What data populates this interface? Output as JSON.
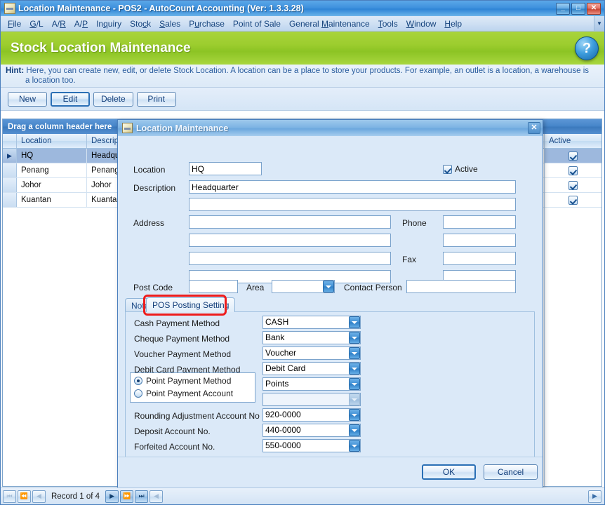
{
  "window": {
    "title": "Location Maintenance - POS2 - AutoCount Accounting (Ver: 1.3.3.28)",
    "icon": "app-icon",
    "minimize": "_",
    "maximize": "□",
    "close": "✕"
  },
  "menubar": {
    "items": [
      {
        "pre": "",
        "key": "F",
        "post": "ile"
      },
      {
        "pre": "",
        "key": "G",
        "post": "/L"
      },
      {
        "pre": "A/",
        "key": "R",
        "post": ""
      },
      {
        "pre": "A/",
        "key": "P",
        "post": ""
      },
      {
        "pre": "In",
        "key": "q",
        "post": "uiry"
      },
      {
        "pre": "Sto",
        "key": "c",
        "post": "k"
      },
      {
        "pre": "",
        "key": "S",
        "post": "ales"
      },
      {
        "pre": "P",
        "key": "u",
        "post": "rchase"
      },
      {
        "pre": "Point of Sale",
        "key": "",
        "post": ""
      },
      {
        "pre": "General ",
        "key": "M",
        "post": "aintenance"
      },
      {
        "pre": "",
        "key": "T",
        "post": "ools"
      },
      {
        "pre": "",
        "key": "W",
        "post": "indow"
      },
      {
        "pre": "",
        "key": "H",
        "post": "elp"
      }
    ],
    "overflow": "▼"
  },
  "banner": {
    "title": "Stock Location Maintenance",
    "help_glyph": "?"
  },
  "hint": {
    "label": "Hint:",
    "line1": "Here, you can create new, edit, or delete Stock Location. A location can be a place to store your products. For example, an outlet is a location, a warehouse is",
    "line2": "a location too."
  },
  "toolbar": {
    "new_label": "New",
    "edit_label": "Edit",
    "delete_label": "Delete",
    "print_label": "Print"
  },
  "grid": {
    "drag_hint": "Drag a column header here",
    "columns": [
      "Location",
      "Description"
    ],
    "active_column": "Active",
    "rows": [
      {
        "indicator": "▶",
        "location": "HQ",
        "description": "Headquarters",
        "active": true,
        "selected": true
      },
      {
        "indicator": "",
        "location": "Penang",
        "description": "Penang",
        "active": true,
        "selected": false
      },
      {
        "indicator": "",
        "location": "Johor",
        "description": "Johor",
        "active": true,
        "selected": false
      },
      {
        "indicator": "",
        "location": "Kuantan",
        "description": "Kuantan",
        "active": true,
        "selected": false
      }
    ]
  },
  "dialog": {
    "title": "Location Maintenance",
    "close_glyph": "✕",
    "fields": {
      "location_label": "Location",
      "location_value": "HQ",
      "description_label": "Description",
      "description_value": "Headquarter",
      "description2_value": "",
      "address_label": "Address",
      "address1": "",
      "address2": "",
      "address3": "",
      "address4": "",
      "phone_label": "Phone",
      "phone1": "",
      "phone2": "",
      "fax_label": "Fax",
      "fax1": "",
      "fax2": "",
      "postcode_label": "Post Code",
      "postcode_value": "",
      "area_label": "Area",
      "area_value": "",
      "contact_label": "Contact Person",
      "contact_value": "",
      "active_label": "Active",
      "active_checked": true
    },
    "tabs": [
      {
        "label": "Note",
        "active": false
      },
      {
        "label": "POS Posting Setting",
        "active": true
      }
    ],
    "pos_posting": {
      "rows": [
        {
          "label": "Cash Payment Method",
          "value": "CASH",
          "disabled": false
        },
        {
          "label": "Cheque Payment Method",
          "value": "Bank",
          "disabled": false
        },
        {
          "label": "Voucher Payment Method",
          "value": "Voucher",
          "disabled": false
        },
        {
          "label": "Debit Card Payment Method",
          "value": "Debit Card",
          "disabled": false
        }
      ],
      "point_method_label": "Point Payment Method",
      "point_method_selected": true,
      "point_account_label": "Point Payment Account",
      "point_account_selected": false,
      "point_method_value": "Points",
      "point_account_value": "",
      "tail_rows": [
        {
          "label": "Rounding Adjustment Account No",
          "value": "920-0000"
        },
        {
          "label": "Deposit Account No.",
          "value": "440-0000"
        },
        {
          "label": "Forfeited Account No.",
          "value": "550-0000"
        }
      ]
    },
    "ok_label": "OK",
    "cancel_label": "Cancel"
  },
  "statusbar": {
    "first_glyph": "⏮",
    "prev_page_glyph": "⏪",
    "prev_glyph": "◀",
    "record_text": "Record 1 of 4",
    "next_glyph": "▶",
    "next_page_glyph": "⏩",
    "last_glyph": "⏭",
    "extra_glyph": "◀",
    "right_glyph": "▶"
  },
  "colors": {
    "accent_blue": "#3f92de",
    "banner_green": "#9ccd2e",
    "highlight_red": "#ee1c1c",
    "selection": "#9db8dd"
  }
}
